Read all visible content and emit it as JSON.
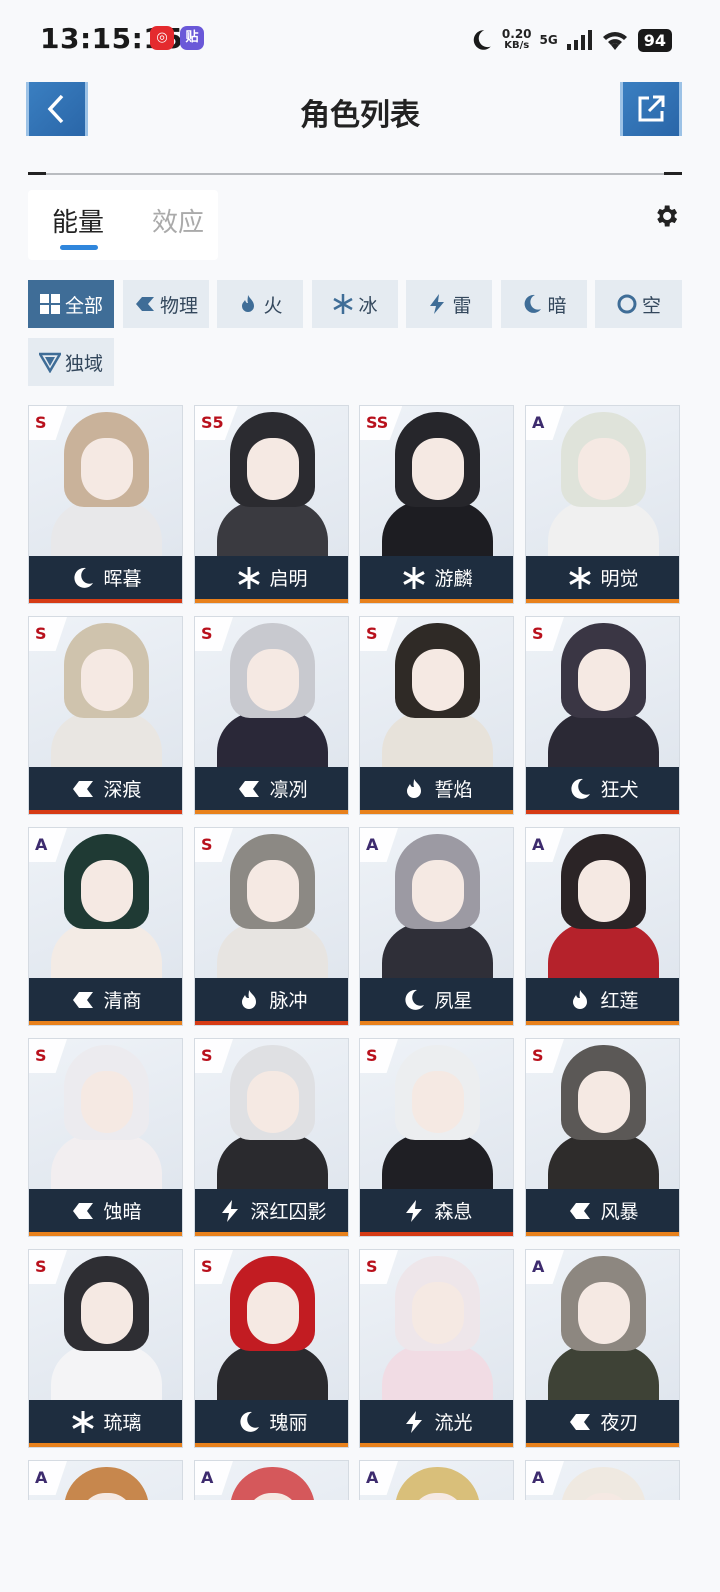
{
  "status": {
    "time": "13:15:15",
    "notif1": "◎",
    "notif2": "贴",
    "net_speed_value": "0.20",
    "net_speed_unit": "KB/s",
    "network": "5G",
    "battery": "94"
  },
  "header": {
    "title": "角色列表"
  },
  "tabs": [
    {
      "label": "能量",
      "active": true
    },
    {
      "label": "效应",
      "active": false
    }
  ],
  "filters": [
    {
      "label": "全部",
      "icon": "grid-icon",
      "active": true
    },
    {
      "label": "物理",
      "icon": "physical-icon"
    },
    {
      "label": "火",
      "icon": "fire-icon"
    },
    {
      "label": "冰",
      "icon": "ice-icon"
    },
    {
      "label": "雷",
      "icon": "thunder-icon"
    },
    {
      "label": "暗",
      "icon": "dark-icon"
    },
    {
      "label": "空",
      "icon": "void-icon"
    },
    {
      "label": "独域",
      "icon": "domain-icon"
    }
  ],
  "characters": [
    {
      "name": "晖暮",
      "rank": "S",
      "element": "dark",
      "hair": "#c9b29a",
      "outfit": "#e8e8ea",
      "bar": "red"
    },
    {
      "name": "启明",
      "rank": "S5",
      "element": "ice",
      "hair": "#2b2b30",
      "outfit": "#3a3a40",
      "bar": "orange"
    },
    {
      "name": "游麟",
      "rank": "SS",
      "element": "ice",
      "hair": "#26262b",
      "outfit": "#1d1d22",
      "bar": "orange"
    },
    {
      "name": "明觉",
      "rank": "A",
      "element": "ice",
      "hair": "#dfe3da",
      "outfit": "#f0f0f0",
      "bar": "orange"
    },
    {
      "name": "深痕",
      "rank": "S",
      "element": "physical",
      "hair": "#cfc3ad",
      "outfit": "#e9e6e2",
      "bar": "red"
    },
    {
      "name": "凛冽",
      "rank": "S",
      "element": "physical",
      "hair": "#c8c9cf",
      "outfit": "#2a2838",
      "bar": "orange"
    },
    {
      "name": "誓焰",
      "rank": "S",
      "element": "fire",
      "hair": "#2f2a26",
      "outfit": "#e7e2da",
      "bar": "orange"
    },
    {
      "name": "狂犬",
      "rank": "S",
      "element": "dark",
      "hair": "#3a3644",
      "outfit": "#2b2935",
      "bar": "red"
    },
    {
      "name": "清商",
      "rank": "A",
      "element": "physical",
      "hair": "#1f3a34",
      "outfit": "#f3ebe5",
      "bar": "orange"
    },
    {
      "name": "脉冲",
      "rank": "S",
      "element": "fire",
      "hair": "#8c8984",
      "outfit": "#e7e4e1",
      "bar": "red"
    },
    {
      "name": "夙星",
      "rank": "A",
      "element": "dark",
      "hair": "#9c9aa3",
      "outfit": "#2f2f38",
      "bar": "orange"
    },
    {
      "name": "红莲",
      "rank": "A",
      "element": "fire",
      "hair": "#2b2426",
      "outfit": "#b5222b",
      "bar": "orange"
    },
    {
      "name": "蚀暗",
      "rank": "S",
      "element": "physical",
      "hair": "#ecebef",
      "outfit": "#f2eef0",
      "bar": "orange"
    },
    {
      "name": "深红囚影",
      "rank": "S",
      "element": "thunder",
      "hair": "#dfe0e3",
      "outfit": "#2a2a2e",
      "bar": "orange"
    },
    {
      "name": "森息",
      "rank": "S",
      "element": "thunder",
      "hair": "#eceef0",
      "outfit": "#1f1f24",
      "bar": "red"
    },
    {
      "name": "风暴",
      "rank": "S",
      "element": "physical",
      "hair": "#5b5856",
      "outfit": "#2e2c2b",
      "bar": "orange"
    },
    {
      "name": "琉璃",
      "rank": "S",
      "element": "ice",
      "hair": "#2e2e33",
      "outfit": "#f4f4f6",
      "bar": "orange"
    },
    {
      "name": "瑰丽",
      "rank": "S",
      "element": "dark",
      "hair": "#c21c22",
      "outfit": "#2a2a2e",
      "bar": "orange"
    },
    {
      "name": "流光",
      "rank": "S",
      "element": "thunder",
      "hair": "#eee6ea",
      "outfit": "#f1dce4",
      "bar": "orange"
    },
    {
      "name": "夜刃",
      "rank": "A",
      "element": "physical",
      "hair": "#8d8780",
      "outfit": "#3e4236",
      "bar": "orange"
    },
    {
      "name": "",
      "rank": "A",
      "element": "",
      "hair": "#c7874d",
      "outfit": "#eef2f7",
      "bar": "orange"
    },
    {
      "name": "",
      "rank": "A",
      "element": "",
      "hair": "#d5585b",
      "outfit": "#eef2f7",
      "bar": "orange"
    },
    {
      "name": "",
      "rank": "A",
      "element": "",
      "hair": "#d9bf7a",
      "outfit": "#eef2f7",
      "bar": "orange"
    },
    {
      "name": "",
      "rank": "A",
      "element": "",
      "hair": "#efe9e1",
      "outfit": "#eef2f7",
      "bar": "orange"
    }
  ]
}
